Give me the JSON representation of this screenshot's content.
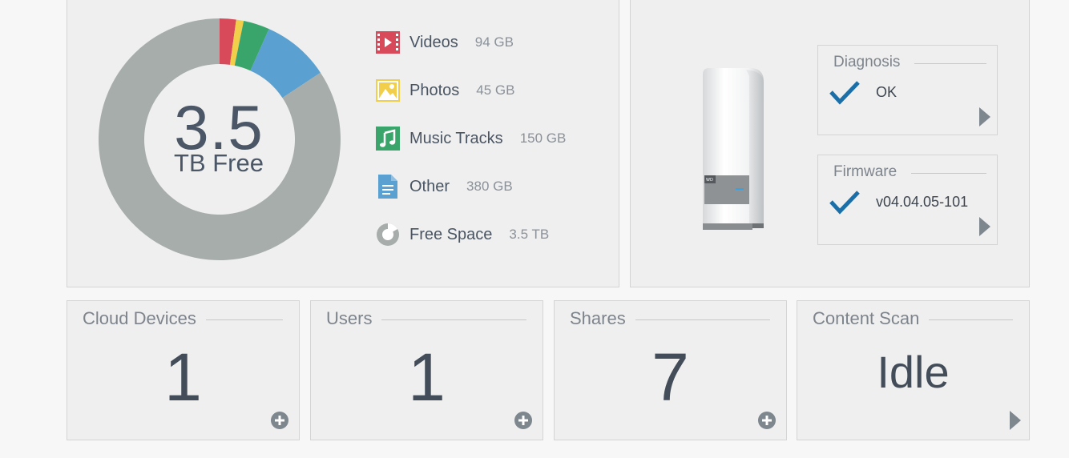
{
  "capacity": {
    "free_value": "3.5",
    "free_unit": "TB Free",
    "legend": [
      {
        "key": "videos",
        "label": "Videos",
        "size": "94 GB",
        "color": "#d84a5a",
        "icon": "video-icon"
      },
      {
        "key": "photos",
        "label": "Photos",
        "size": "45 GB",
        "color": "#f2cf4a",
        "icon": "photo-icon"
      },
      {
        "key": "music",
        "label": "Music Tracks",
        "size": "150 GB",
        "color": "#3aa56a",
        "icon": "music-icon"
      },
      {
        "key": "other",
        "label": "Other",
        "size": "380 GB",
        "color": "#5aa0d0",
        "icon": "document-icon"
      },
      {
        "key": "free",
        "label": "Free Space",
        "size": "3.5 TB",
        "color": "#a7adab",
        "icon": "pie-icon"
      }
    ],
    "donut_fractions": {
      "videos": 0.022,
      "photos": 0.01,
      "music": 0.035,
      "other": 0.09,
      "free": 0.843
    }
  },
  "device": {
    "diagnosis": {
      "title": "Diagnosis",
      "value": "OK"
    },
    "firmware": {
      "title": "Firmware",
      "value": "v04.04.05-101"
    }
  },
  "tiles": [
    {
      "key": "cloud_devices",
      "title": "Cloud Devices",
      "value": "1",
      "action": "add"
    },
    {
      "key": "users",
      "title": "Users",
      "value": "1",
      "action": "add"
    },
    {
      "key": "shares",
      "title": "Shares",
      "value": "7",
      "action": "add"
    },
    {
      "key": "content_scan",
      "title": "Content Scan",
      "value": "Idle",
      "action": "arrow"
    }
  ],
  "colors": {
    "accent_check": "#1a6fa8",
    "icon_gray": "#9aa0a6"
  }
}
